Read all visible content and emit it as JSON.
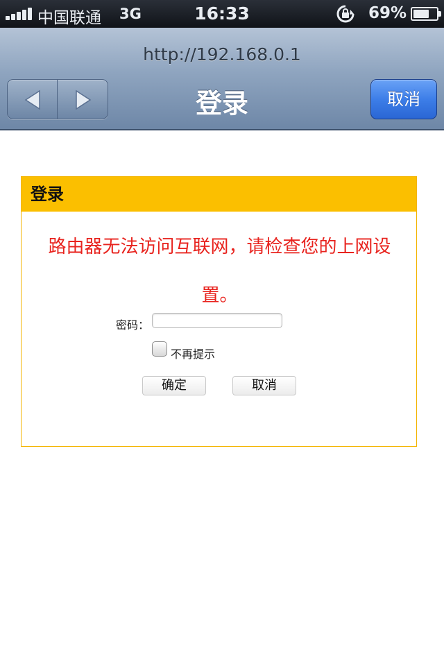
{
  "status_bar": {
    "carrier": "中国联通",
    "network": "3G",
    "time": "16:33",
    "battery_percent": "69%",
    "battery_level": 0.69,
    "icons": [
      "signal-icon",
      "rotation-lock-icon",
      "battery-icon"
    ]
  },
  "nav_bar": {
    "url": "http://192.168.0.1",
    "title": "登录",
    "cancel_label": "取消",
    "back_icon": "back-arrow-icon",
    "forward_icon": "forward-arrow-icon"
  },
  "login": {
    "header": "登录",
    "warning": "路由器无法访问互联网，请检查您的上网设置。",
    "password_label": "密码：",
    "password_value": "",
    "dont_remind_label": "不再提示",
    "dont_remind_checked": false,
    "ok_label": "确定",
    "cancel_label": "取消"
  },
  "colors": {
    "header_yellow": "#fbbf00",
    "warning_red": "#e8231e",
    "nav_blue_button": "#3d7ee8"
  }
}
